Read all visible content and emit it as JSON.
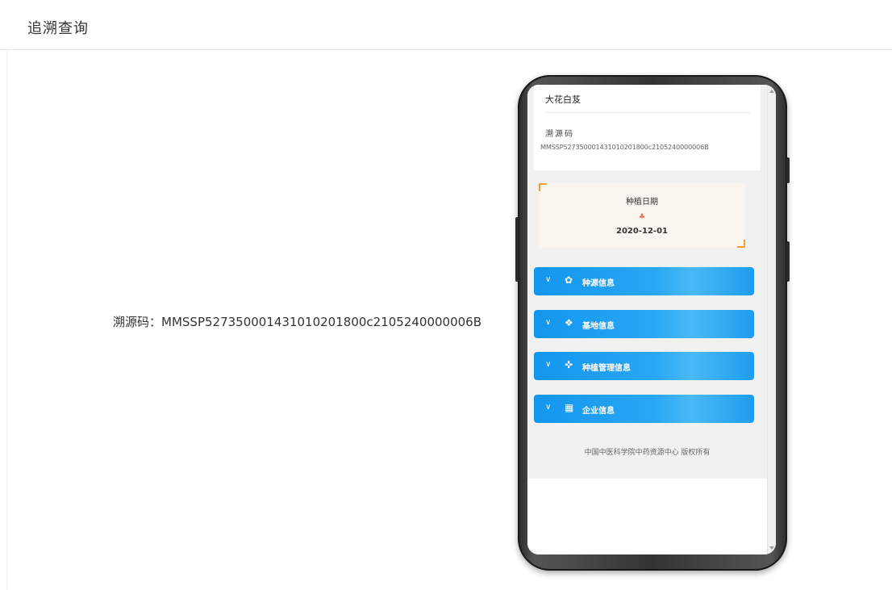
{
  "header": {
    "title": "追溯查询"
  },
  "trace": {
    "label": "溯源码：",
    "code": "MMSSP52735000143101020180 0c2105240000006B"
  },
  "phone": {
    "product_name": "大花白芨",
    "code_label": "溯源码",
    "code_value": "MMSSP527350001431010201800c2105240000006B",
    "planting_date_label": "种植日期",
    "planting_date": "2020-12-01",
    "sections": [
      {
        "label": "种源信息",
        "icon": "seed-icon",
        "glyph": "✿"
      },
      {
        "label": "基地信息",
        "icon": "base-icon",
        "glyph": "❖"
      },
      {
        "label": "种植管理信息",
        "icon": "cultivation-icon",
        "glyph": "✜"
      },
      {
        "label": "企业信息",
        "icon": "enterprise-icon",
        "glyph": "▦"
      }
    ],
    "footer": "中国中医科学院中药资源中心 版权所有"
  },
  "colors": {
    "accent": "#1296ee",
    "corner": "#f0a030",
    "date_bg": "#fbf5ef"
  }
}
